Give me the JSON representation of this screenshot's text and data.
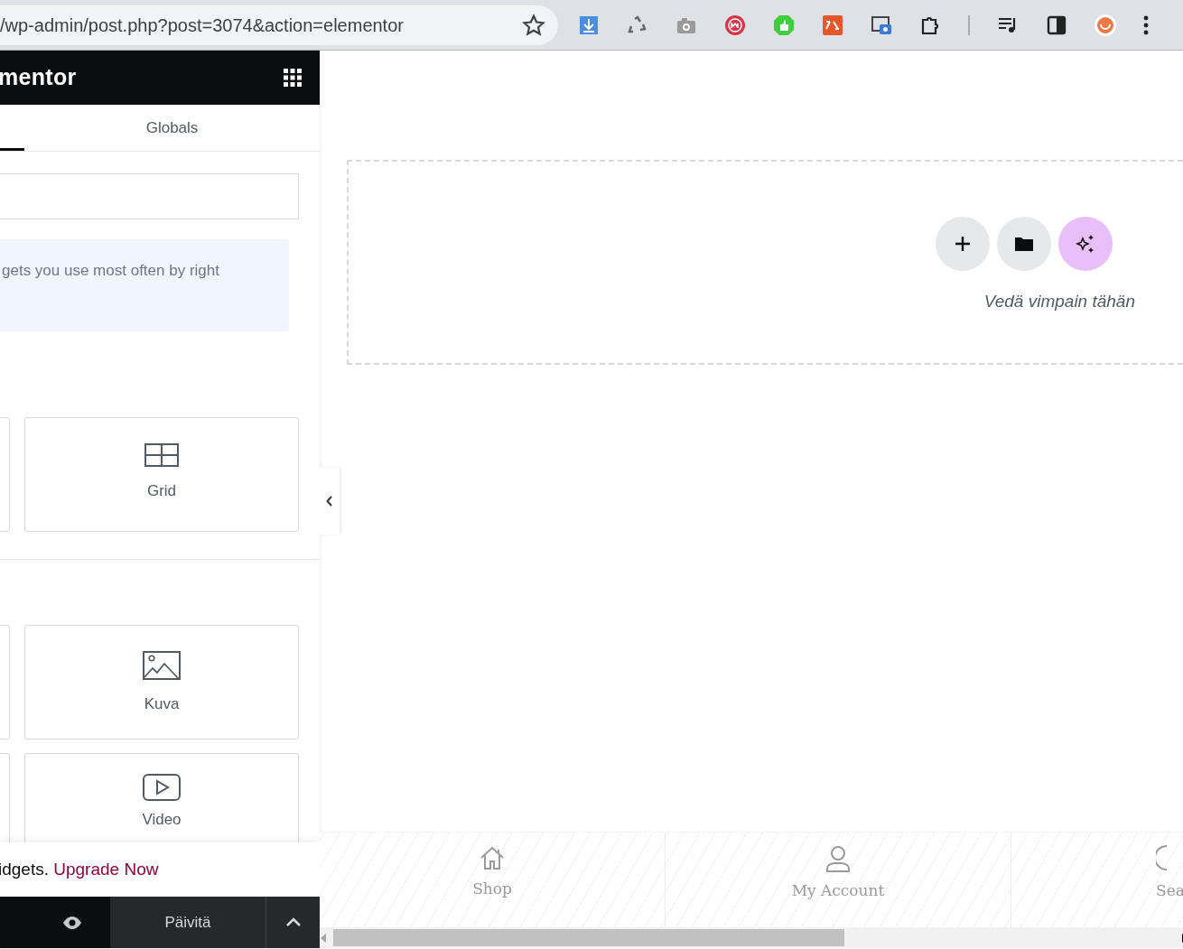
{
  "browser": {
    "url": "/wp-admin/post.php?post=3074&action=elementor"
  },
  "panel": {
    "logo": "mentor",
    "tabs": [
      {
        "selected": true
      },
      {
        "label": "Globals",
        "selected": false
      }
    ],
    "info": "gets you use most often by right",
    "sections": [
      {
        "widgets": [
          {
            "kind": "partial"
          },
          {
            "kind": "grid",
            "label": "Grid"
          }
        ]
      },
      {
        "widgets": [
          {
            "kind": "partial"
          },
          {
            "kind": "image",
            "label": "Kuva"
          }
        ]
      },
      {
        "widgets": [
          {
            "kind": "partial"
          },
          {
            "kind": "video",
            "label": "Video"
          }
        ]
      }
    ],
    "upgrade": {
      "text": "idgets.",
      "link": "Upgrade Now"
    },
    "footer": {
      "update": "Päivitä"
    }
  },
  "canvas": {
    "drop_hint": "Vedä vimpain tähän",
    "nav": [
      {
        "kind": "home",
        "label": "Shop"
      },
      {
        "kind": "user",
        "label": "My Account"
      },
      {
        "kind": "search",
        "label": "Sea"
      }
    ]
  }
}
